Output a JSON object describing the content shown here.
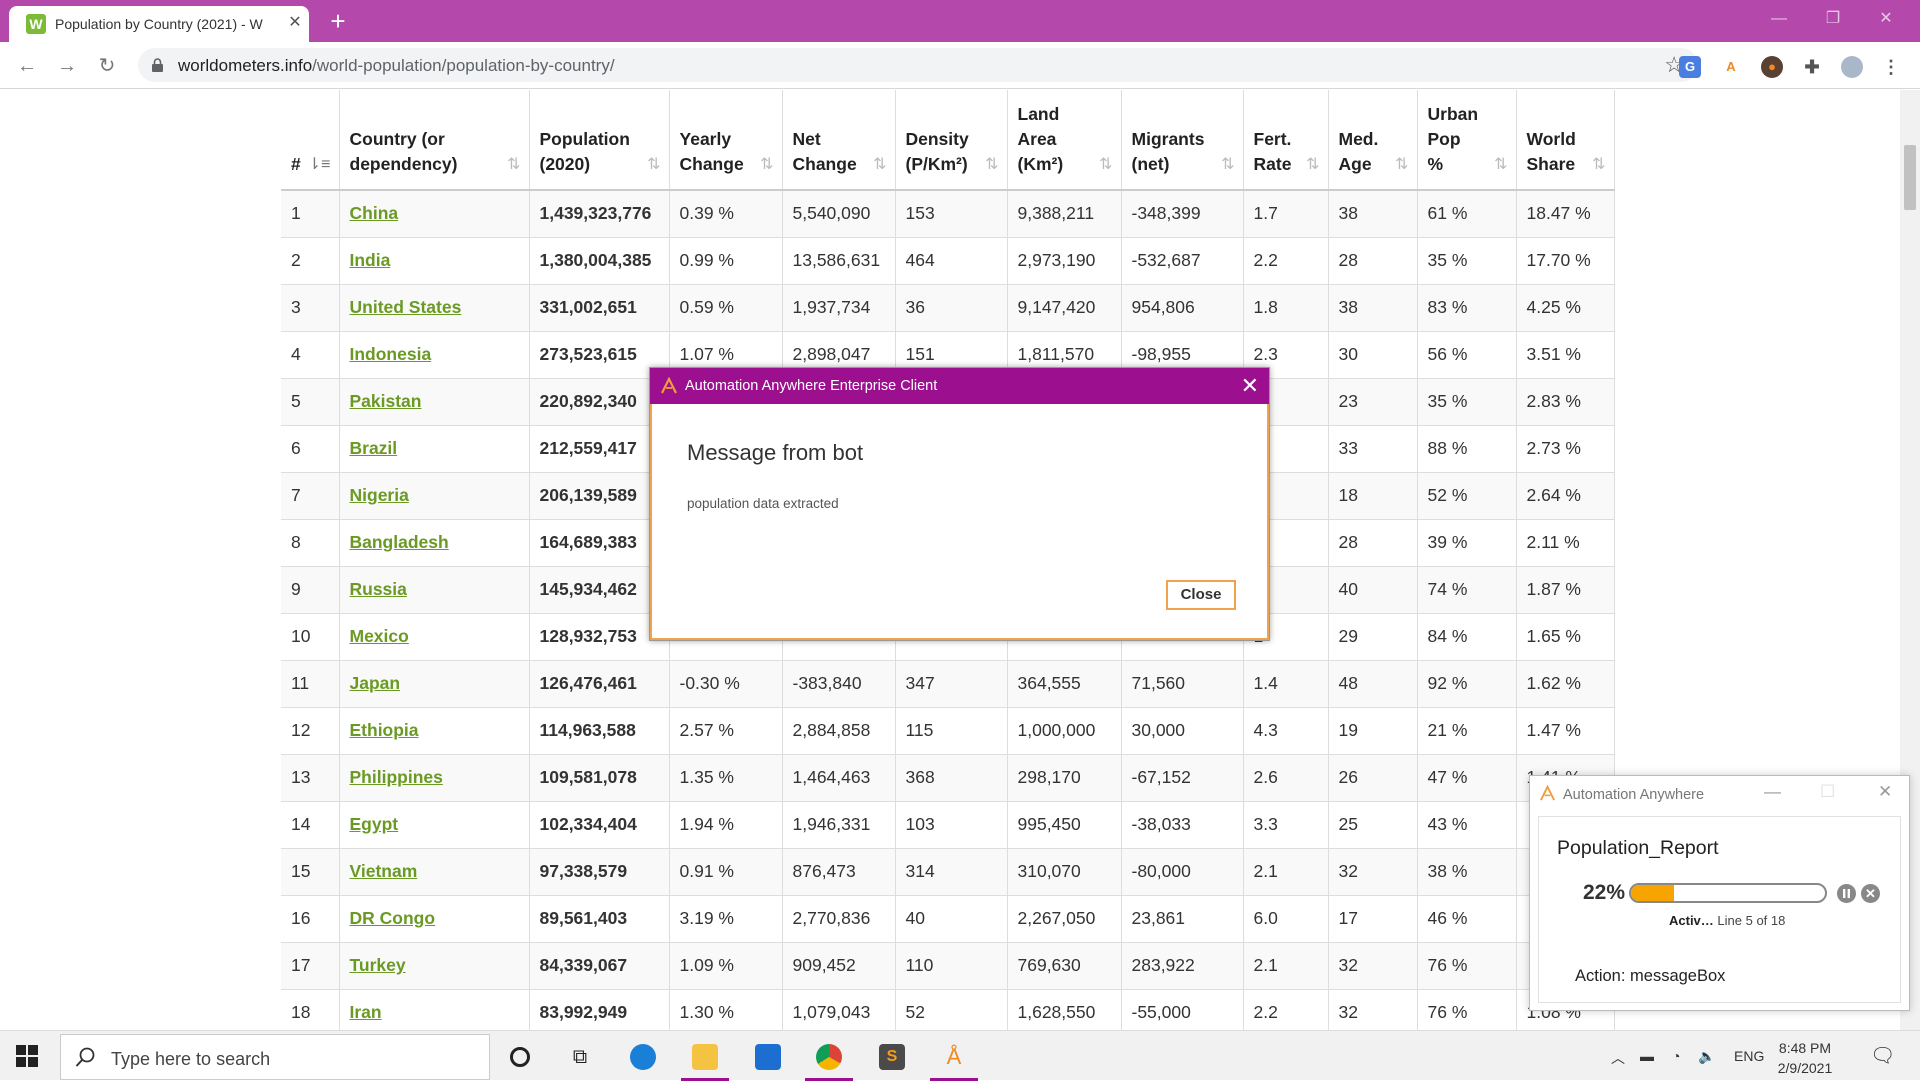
{
  "browser": {
    "tab_title": "Population by Country (2021) - W",
    "tab_favicon": "W",
    "url_domain": "worldometers.info",
    "url_path": "/world-population/population-by-country/"
  },
  "table": {
    "headers": [
      {
        "l1": "#",
        "l2": ""
      },
      {
        "l1": "Country (or",
        "l2": "dependency)"
      },
      {
        "l1": "Population",
        "l2": "(2020)"
      },
      {
        "l1": "Yearly",
        "l2": "Change"
      },
      {
        "l1": "Net",
        "l2": "Change"
      },
      {
        "l1": "Density",
        "l2": "(P/Km²)"
      },
      {
        "l1": "Land",
        "l1b": "Area",
        "l2": "(Km²)"
      },
      {
        "l1": "Migrants",
        "l2": "(net)"
      },
      {
        "l1": "Fert.",
        "l2": "Rate"
      },
      {
        "l1": "Med.",
        "l2": "Age"
      },
      {
        "l1": "Urban",
        "l1b": "Pop",
        "l2": "%"
      },
      {
        "l1": "World",
        "l2": "Share"
      }
    ],
    "rows": [
      [
        "1",
        "China",
        "1,439,323,776",
        "0.39 %",
        "5,540,090",
        "153",
        "9,388,211",
        "-348,399",
        "1.7",
        "38",
        "61 %",
        "18.47 %"
      ],
      [
        "2",
        "India",
        "1,380,004,385",
        "0.99 %",
        "13,586,631",
        "464",
        "2,973,190",
        "-532,687",
        "2.2",
        "28",
        "35 %",
        "17.70 %"
      ],
      [
        "3",
        "United States",
        "331,002,651",
        "0.59 %",
        "1,937,734",
        "36",
        "9,147,420",
        "954,806",
        "1.8",
        "38",
        "83 %",
        "4.25 %"
      ],
      [
        "4",
        "Indonesia",
        "273,523,615",
        "1.07 %",
        "2,898,047",
        "151",
        "1,811,570",
        "-98,955",
        "2.3",
        "30",
        "56 %",
        "3.51 %"
      ],
      [
        "5",
        "Pakistan",
        "220,892,340",
        "",
        "",
        "",
        "",
        "",
        "6",
        "23",
        "35 %",
        "2.83 %"
      ],
      [
        "6",
        "Brazil",
        "212,559,417",
        "",
        "",
        "",
        "",
        "",
        "7",
        "33",
        "88 %",
        "2.73 %"
      ],
      [
        "7",
        "Nigeria",
        "206,139,589",
        "",
        "",
        "",
        "",
        "",
        "4",
        "18",
        "52 %",
        "2.64 %"
      ],
      [
        "8",
        "Bangladesh",
        "164,689,383",
        "",
        "",
        "",
        "",
        "",
        "1",
        "28",
        "39 %",
        "2.11 %"
      ],
      [
        "9",
        "Russia",
        "145,934,462",
        "",
        "",
        "",
        "",
        "",
        "8",
        "40",
        "74 %",
        "1.87 %"
      ],
      [
        "10",
        "Mexico",
        "128,932,753",
        "",
        "",
        "",
        "",
        "",
        "1",
        "29",
        "84 %",
        "1.65 %"
      ],
      [
        "11",
        "Japan",
        "126,476,461",
        "-0.30 %",
        "-383,840",
        "347",
        "364,555",
        "71,560",
        "1.4",
        "48",
        "92 %",
        "1.62 %"
      ],
      [
        "12",
        "Ethiopia",
        "114,963,588",
        "2.57 %",
        "2,884,858",
        "115",
        "1,000,000",
        "30,000",
        "4.3",
        "19",
        "21 %",
        "1.47 %"
      ],
      [
        "13",
        "Philippines",
        "109,581,078",
        "1.35 %",
        "1,464,463",
        "368",
        "298,170",
        "-67,152",
        "2.6",
        "26",
        "47 %",
        "1.41 %"
      ],
      [
        "14",
        "Egypt",
        "102,334,404",
        "1.94 %",
        "1,946,331",
        "103",
        "995,450",
        "-38,033",
        "3.3",
        "25",
        "43 %",
        ""
      ],
      [
        "15",
        "Vietnam",
        "97,338,579",
        "0.91 %",
        "876,473",
        "314",
        "310,070",
        "-80,000",
        "2.1",
        "32",
        "38 %",
        ""
      ],
      [
        "16",
        "DR Congo",
        "89,561,403",
        "3.19 %",
        "2,770,836",
        "40",
        "2,267,050",
        "23,861",
        "6.0",
        "17",
        "46 %",
        ""
      ],
      [
        "17",
        "Turkey",
        "84,339,067",
        "1.09 %",
        "909,452",
        "110",
        "769,630",
        "283,922",
        "2.1",
        "32",
        "76 %",
        ""
      ],
      [
        "18",
        "Iran",
        "83,992,949",
        "1.30 %",
        "1,079,043",
        "52",
        "1,628,550",
        "-55,000",
        "2.2",
        "32",
        "76 %",
        "1.08 %"
      ]
    ]
  },
  "dialog": {
    "title": "Automation Anywhere Enterprise Client",
    "heading": "Message from bot",
    "message": "population data extracted",
    "close_label": "Close"
  },
  "progress": {
    "window_title": "Automation Anywhere",
    "task_name": "Population_Report",
    "percent_label": "22%",
    "percent_value": 0.22,
    "status_bold": "Activ…",
    "status_rest": "Line 5 of 18",
    "action_text": "Action: messageBox"
  },
  "taskbar": {
    "search_placeholder": "Type here to search",
    "lang": "ENG",
    "time": "8:48 PM",
    "date": "2/9/2021"
  },
  "colors": {
    "tabbar": "#b449ab",
    "dialog_title": "#9c0f8e",
    "dialog_accent": "#f0a24e",
    "country_link": "#6a9a24",
    "progress_fill": "#f7a400"
  }
}
